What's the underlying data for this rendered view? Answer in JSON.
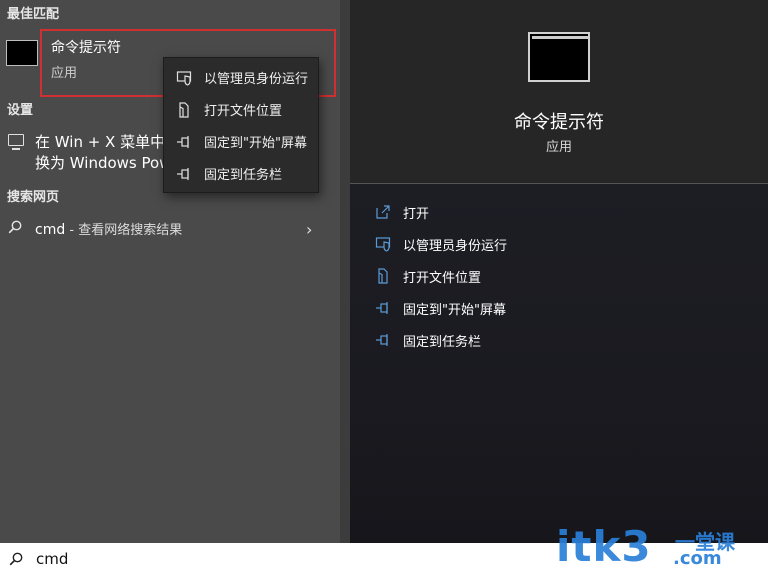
{
  "results": {
    "best_match_header": "最佳匹配",
    "best_match": {
      "title": "命令提示符",
      "subtitle": "应用",
      "icon": "cmd-app-icon"
    },
    "settings_header": "设置",
    "settings_item": {
      "line1": "在 Win + X 菜单中",
      "line2": "换为 Windows Pow",
      "icon": "monitor-icon"
    },
    "web_header": "搜索网页",
    "web_item": {
      "query": "cmd",
      "hint": " - 查看网络搜索结果",
      "icon": "search-icon",
      "chevron": "›"
    }
  },
  "context_menu": {
    "items": [
      {
        "label": "以管理员身份运行",
        "icon": "shield-icon"
      },
      {
        "label": "打开文件位置",
        "icon": "file-location-icon"
      },
      {
        "label": "固定到\"开始\"屏幕",
        "icon": "pin-icon"
      },
      {
        "label": "固定到任务栏",
        "icon": "pin-icon"
      }
    ]
  },
  "details": {
    "title": "命令提示符",
    "subtitle": "应用",
    "actions": [
      {
        "label": "打开",
        "icon": "open-icon"
      },
      {
        "label": "以管理员身份运行",
        "icon": "shield-icon"
      },
      {
        "label": "打开文件位置",
        "icon": "file-location-icon"
      },
      {
        "label": "固定到\"开始\"屏幕",
        "icon": "pin-icon"
      },
      {
        "label": "固定到任务栏",
        "icon": "pin-icon"
      }
    ]
  },
  "search_bar": {
    "value": "cmd",
    "icon": "search-icon"
  },
  "watermark": {
    "main": "itk3",
    "sub": "一堂课",
    "tail": ".com"
  },
  "colors": {
    "accent": "#5b9bd5",
    "highlight_border": "#d03030",
    "watermark": "#2a7fd8"
  }
}
